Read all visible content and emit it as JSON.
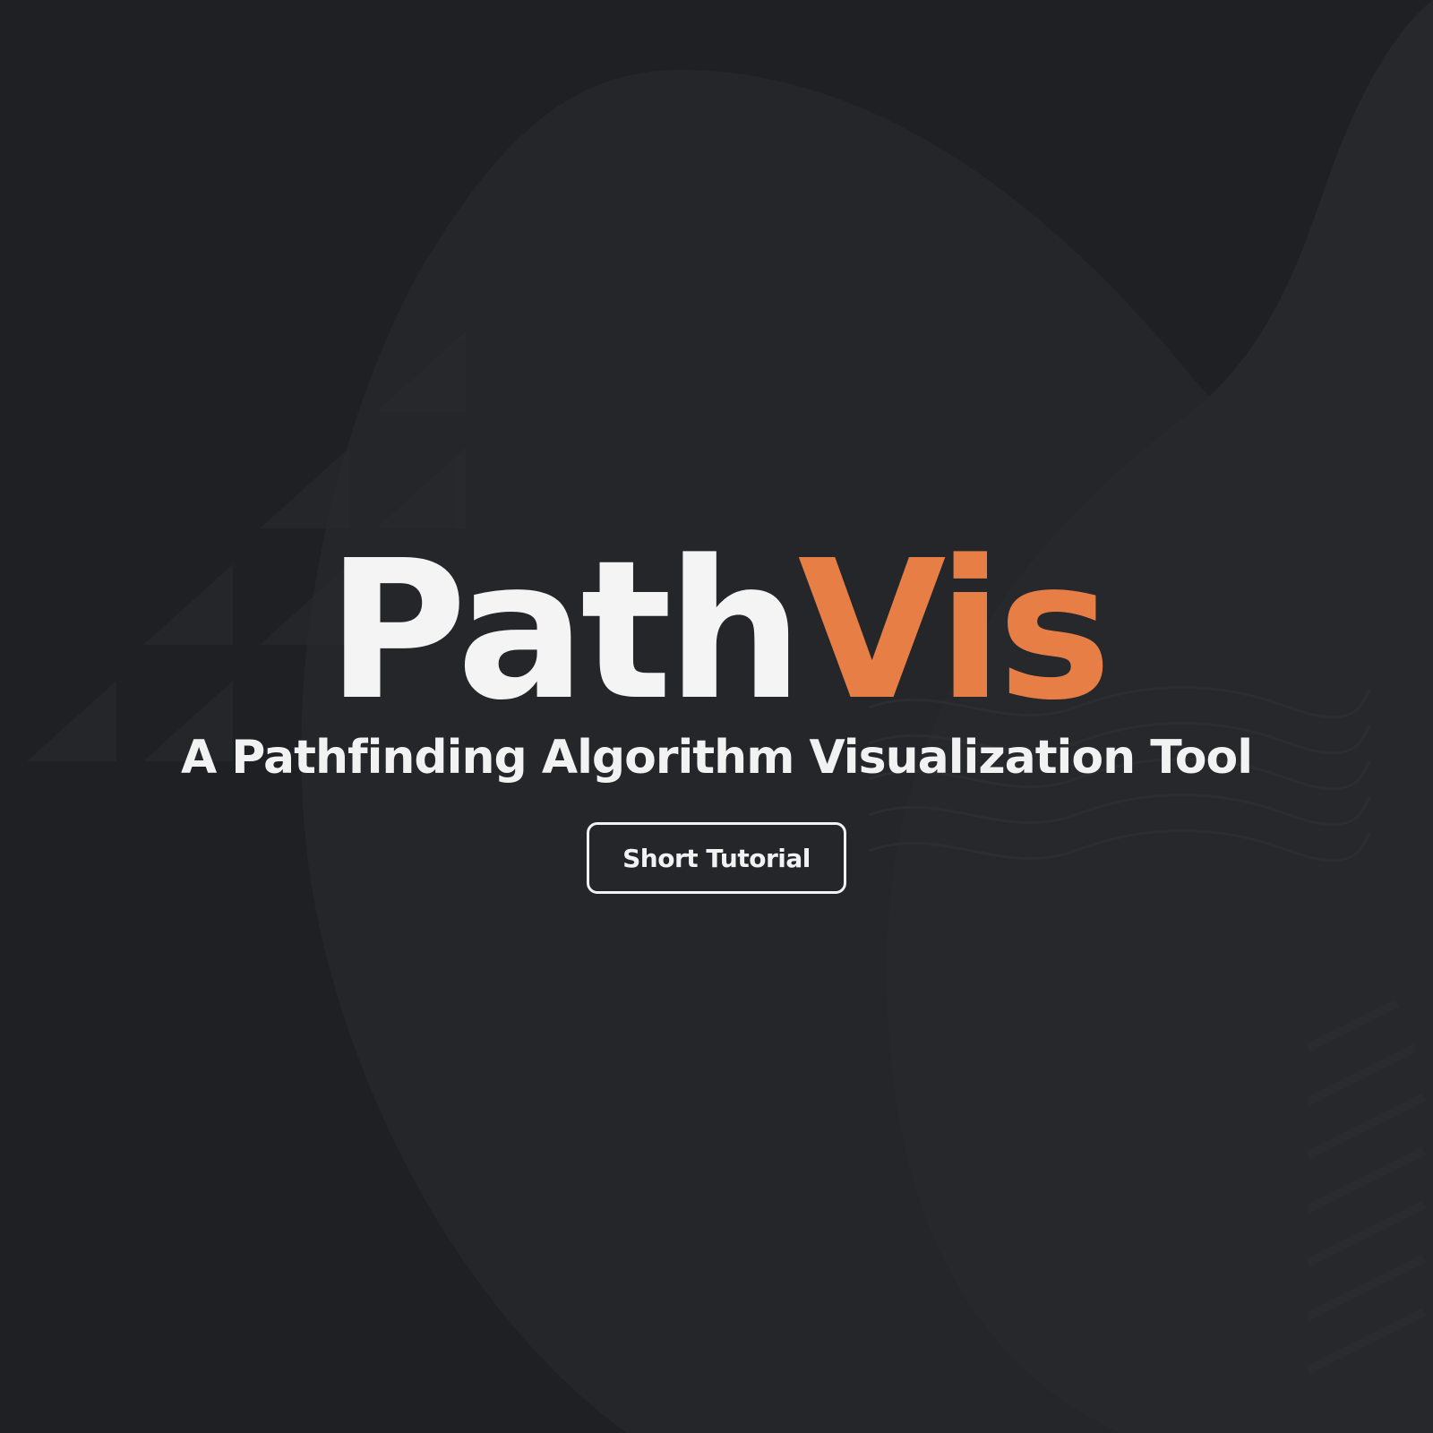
{
  "hero": {
    "title_part1": "Path",
    "title_part2": "Vis",
    "subtitle": "A Pathfinding Algorithm Visualization Tool",
    "tutorial_button_label": "Short Tutorial"
  },
  "colors": {
    "background": "#1f2024",
    "title_primary": "#f4f4f4",
    "title_accent": "#e67e45",
    "button_border": "#f2f2f2"
  }
}
